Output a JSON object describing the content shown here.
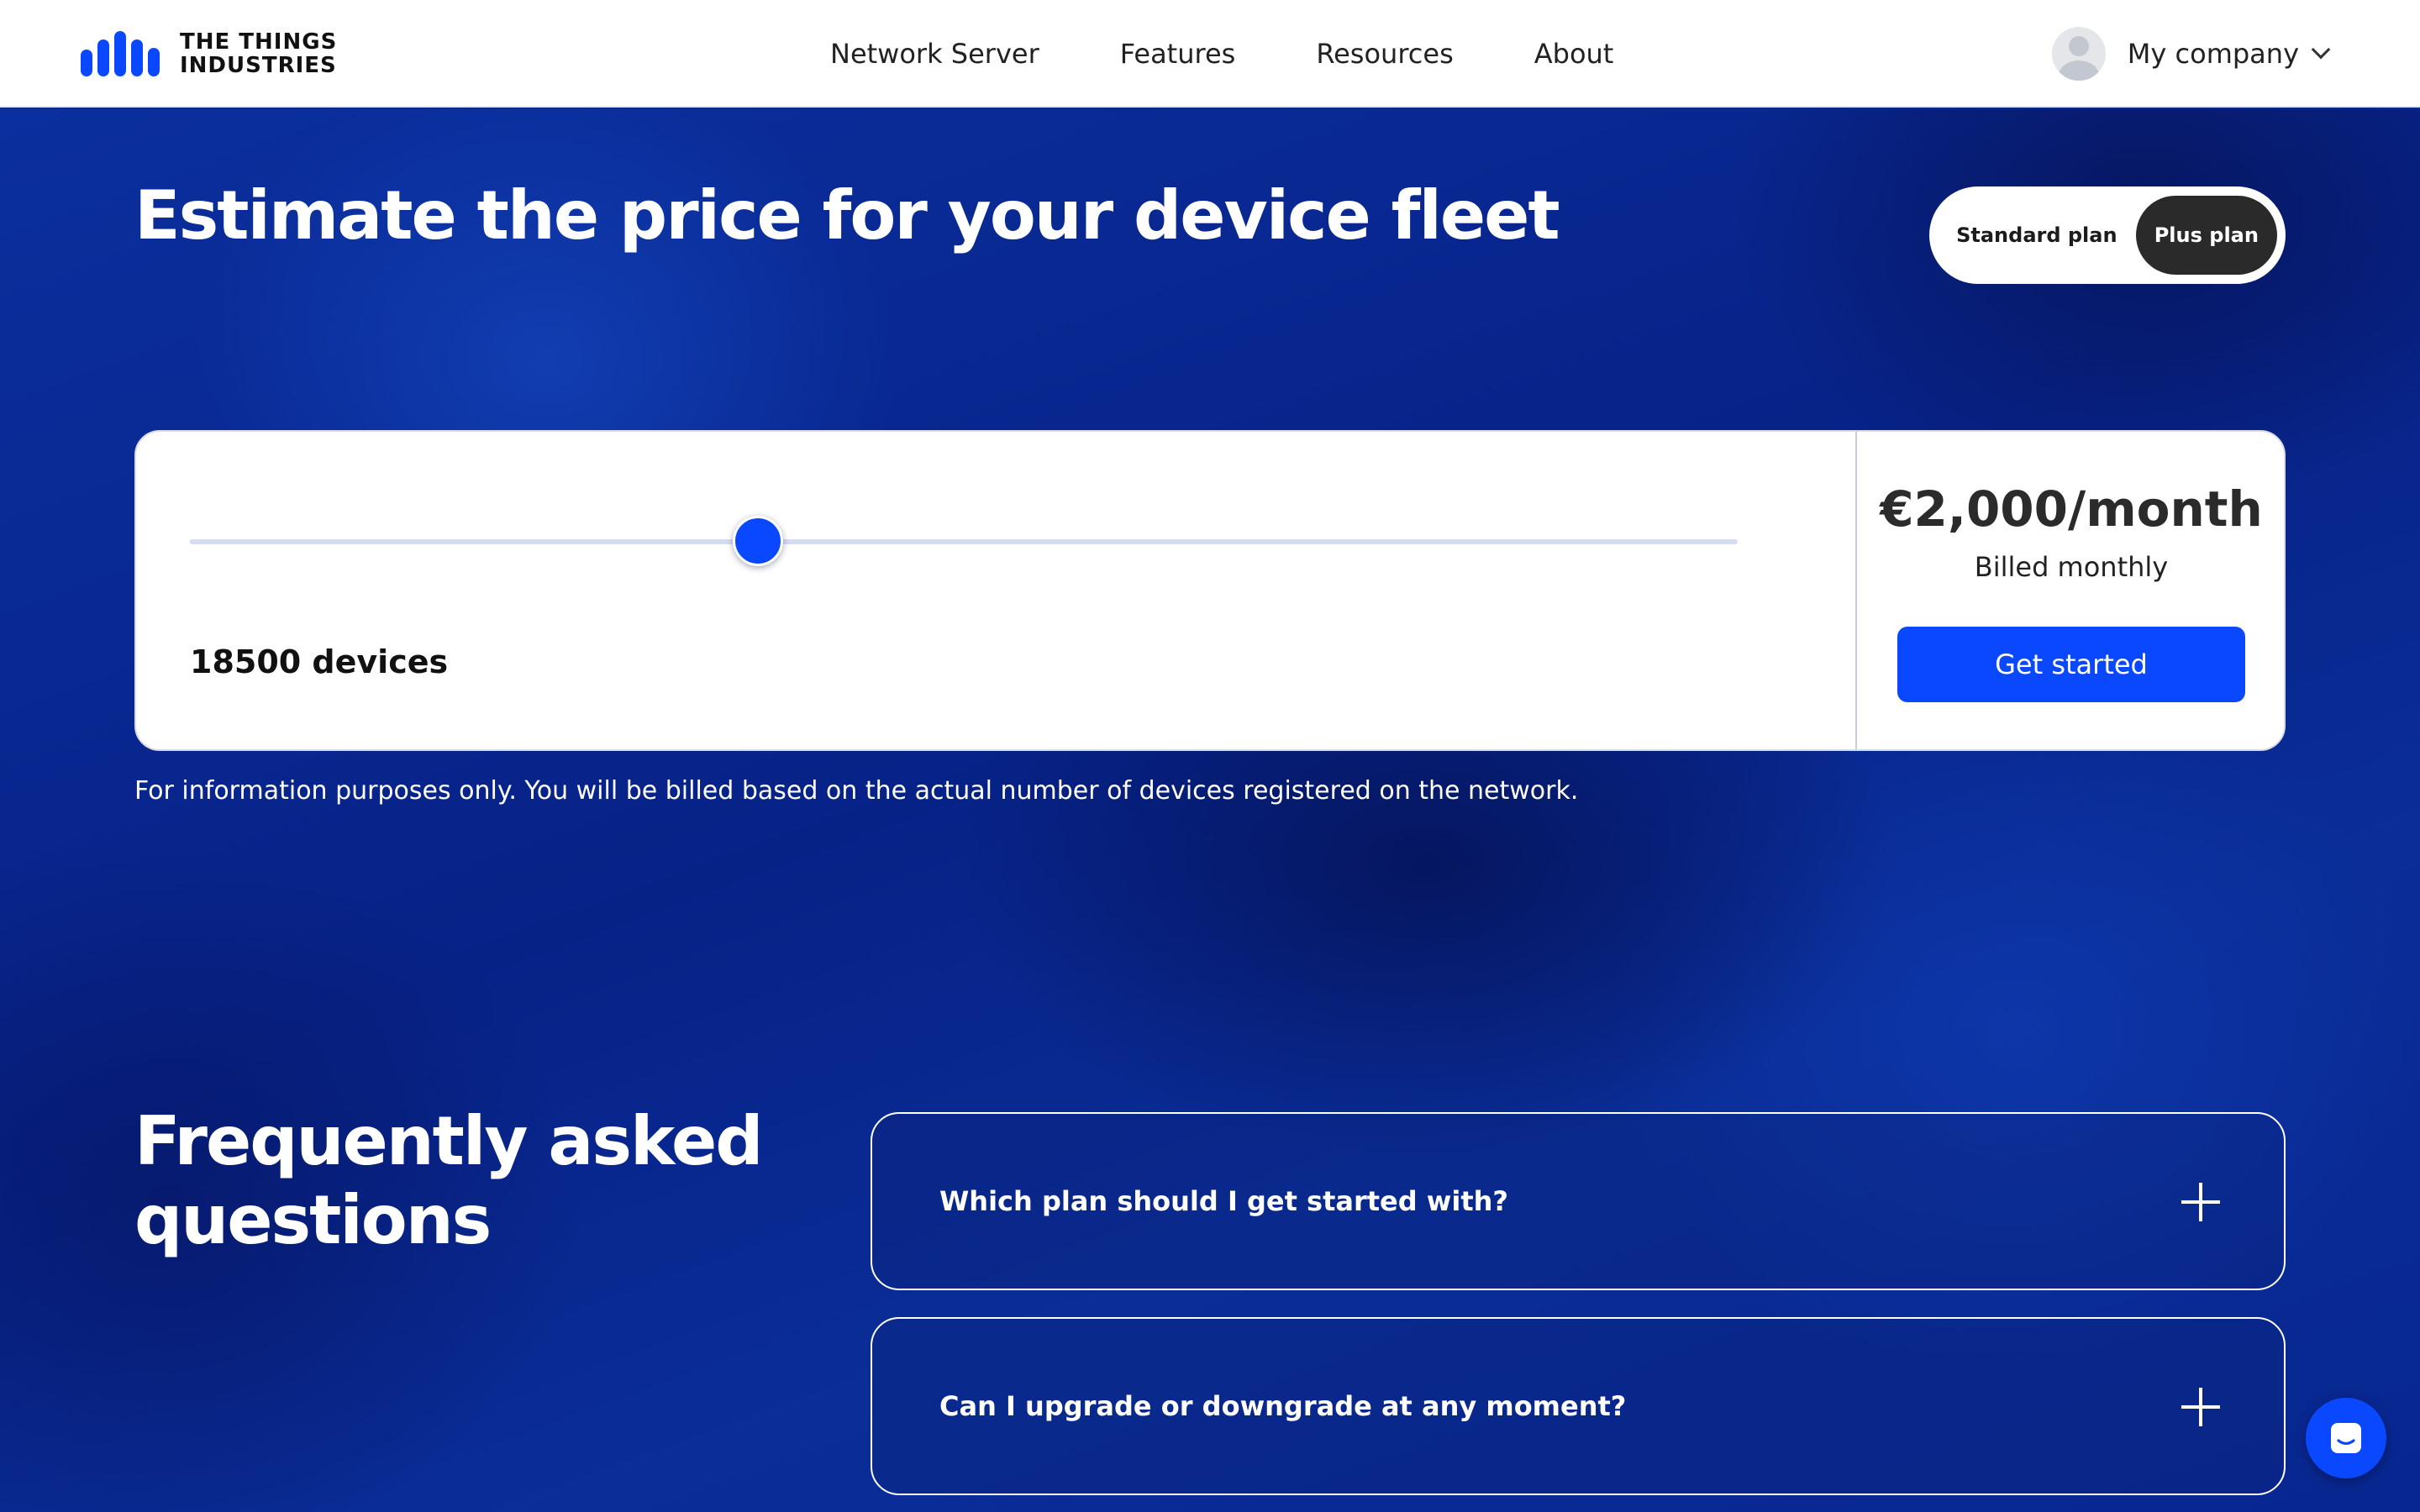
{
  "brand": {
    "logo_line1": "THE THINGS",
    "logo_line2": "INDUSTRIES",
    "accent_color": "#0a48ff"
  },
  "nav": {
    "links": [
      "Network Server",
      "Features",
      "Resources",
      "About"
    ]
  },
  "account": {
    "name": "My company",
    "avatar_icon": "user-avatar-icon",
    "dropdown_icon": "chevron-down-icon"
  },
  "hero": {
    "title": "Estimate the price for your device fleet"
  },
  "plans": {
    "options": [
      "Standard plan",
      "Plus plan"
    ],
    "selected": "Plus plan"
  },
  "calculator": {
    "slider_fraction": 0.367,
    "device_count_label": "18500 devices",
    "price": "€2,000/month",
    "billing": "Billed monthly",
    "cta_label": "Get started",
    "disclaimer": "For information purposes only. You will be billed based on the actual number of devices registered on the network."
  },
  "faq": {
    "title": "Frequently asked questions",
    "items": [
      {
        "question": "Which plan should I get started with?",
        "icon": "plus-icon"
      },
      {
        "question": "Can I upgrade or downgrade at any moment?",
        "icon": "plus-icon"
      }
    ]
  },
  "chat": {
    "icon": "chat-icon"
  }
}
